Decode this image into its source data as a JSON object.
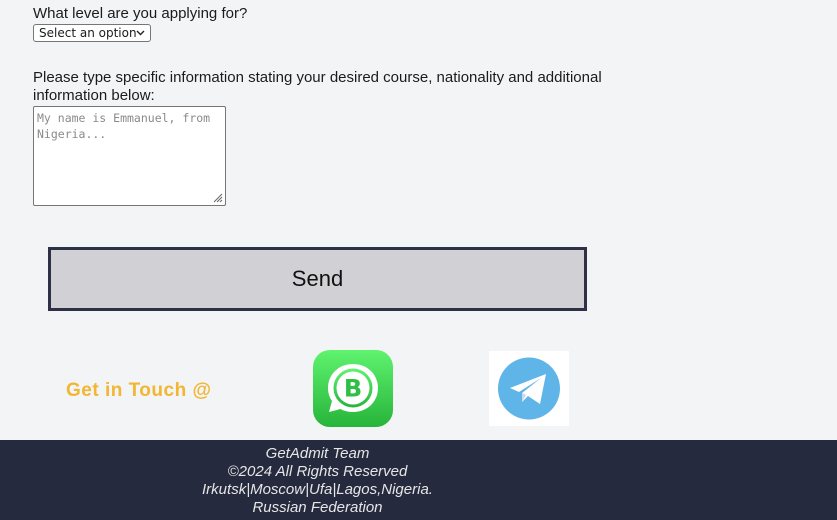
{
  "form": {
    "level_question": "What level are you applying for?",
    "level_select_value": "Select an option",
    "info_question": "Please type specific information stating your desired course, nationality and additional information below:",
    "info_placeholder": "My name is Emmanuel, from Nigeria...",
    "send_label": "Send"
  },
  "contact": {
    "heading": "Get in Touch @",
    "icons": [
      "whatsapp-business-icon",
      "telegram-icon"
    ],
    "accent_color": "#f2b632"
  },
  "footer": {
    "team": "GetAdmit Team",
    "copyright": "©2024 All Rights Reserved",
    "cities": "Irkutsk|Moscow|Ufa|Lagos,Nigeria.",
    "country": "Russian Federation",
    "background": "#262a3e"
  }
}
